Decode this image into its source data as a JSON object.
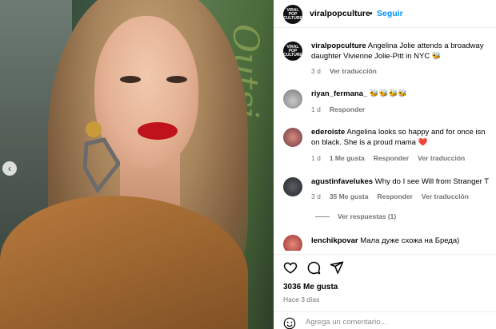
{
  "header": {
    "avatar_text": "VIRAL POP CULTURE",
    "username": "viralpopculture",
    "separator": "•",
    "follow_label": "Seguir"
  },
  "photo": {
    "sign_text": "Outsi"
  },
  "comments": [
    {
      "avatar_text": "VIRAL POP CULTURE",
      "user": "viralpopculture",
      "text": " Angelina Jolie attends a broadway",
      "text_line2": "daughter Vivienne Jolie-Pitt in NYC 🐝",
      "time": "3 d",
      "action1": "Ver traducción"
    },
    {
      "user": "riyan_fermana_",
      "text": " 🐝🐝🐝🐝",
      "time": "1 d",
      "action1": "Responder"
    },
    {
      "user": "ederoiste",
      "text": " Angelina looks so happy and for once isn",
      "text_line2": "on black. She is a proud mama ❤️",
      "time": "1 d",
      "likes": "1 Me gusta",
      "action1": "Responder",
      "action2": "Ver traducción"
    },
    {
      "user": "agustinfavelukes",
      "text": " Why do I see Will from Stranger T",
      "time": "3 d",
      "likes": "35 Me gusta",
      "action1": "Responder",
      "action2": "Ver traducción",
      "replies": "Ver respuestas (1)"
    },
    {
      "user": "lenchikpovar",
      "text": " Мала дуже схожа на Бреда)"
    }
  ],
  "actions": {
    "like_icon": "heart-icon",
    "comment_icon": "comment-icon",
    "share_icon": "send-icon"
  },
  "likes_count": "3036 Me gusta",
  "posted_when": "Hace 3 días",
  "comment_box": {
    "placeholder": "Agrega un comentario...",
    "emoji_icon": "emoji-icon"
  }
}
